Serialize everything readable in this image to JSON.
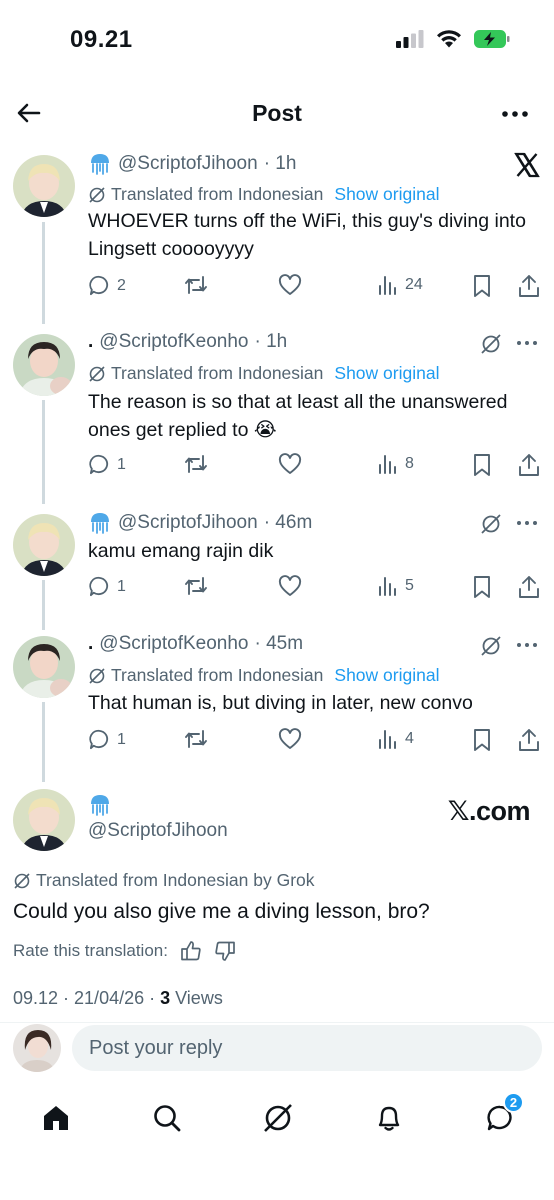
{
  "status_bar": {
    "time": "09.21"
  },
  "nav": {
    "title": "Post"
  },
  "thread": [
    {
      "prefix": "",
      "handle": "@ScriptofJihoon",
      "time": "· 1h",
      "translated": "Translated from Indonesian",
      "show_original": "Show original",
      "text": "WHOEVER turns off the WiFi, this guy's diving into Lingsett cooooyyyy",
      "replies": "2",
      "reposts": "",
      "views": "24",
      "corner_icon": "x-logo-icon"
    },
    {
      "prefix": ".",
      "handle": "@ScriptofKeonho",
      "time": "· 1h",
      "translated": "Translated from Indonesian",
      "show_original": "Show original",
      "text": "The reason is so that at least all the unanswered ones get replied to 😭",
      "replies": "1",
      "views": "8",
      "corner_icon": "grok-icon"
    },
    {
      "prefix": "",
      "handle": "@ScriptofJihoon",
      "time": "· 46m",
      "translated": "",
      "show_original": "",
      "text": "kamu emang rajin dik",
      "replies": "1",
      "views": "5",
      "corner_icon": "grok-icon"
    },
    {
      "prefix": ".",
      "handle": "@ScriptofKeonho",
      "time": "· 45m",
      "translated": "Translated from Indonesian",
      "show_original": "Show original",
      "text": "That human is, but diving in later, new convo",
      "replies": "1",
      "views": "4",
      "corner_icon": "grok-icon"
    }
  ],
  "main_post": {
    "handle": "@ScriptofJihoon",
    "brand": "𝕏.com",
    "translated": "Translated from Indonesian by Grok",
    "text": "Could you also give me a diving lesson, bro?",
    "rate_label": "Rate this translation:",
    "date": "09.12 · 21/04/26 · ",
    "views_count": "3",
    "views_label": " Views"
  },
  "reply": {
    "placeholder": "Post your reply"
  },
  "tabbar": {
    "messages_badge": "2"
  },
  "colors": {
    "accent": "#1d9bf0",
    "secondary_text": "#536471",
    "battery": "#34c759"
  }
}
